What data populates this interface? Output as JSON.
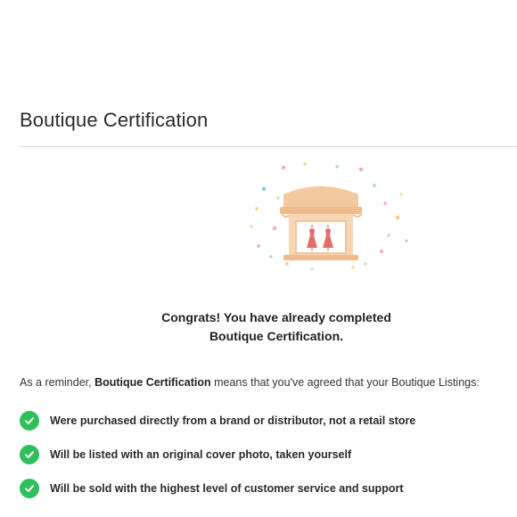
{
  "page": {
    "title": "Boutique Certification"
  },
  "congrats": {
    "line1": "Congrats! You have already completed",
    "line2": "Boutique Certification."
  },
  "reminder": {
    "prefix": "As a reminder, ",
    "emphasis": "Boutique Certification",
    "suffix": " means that you've agreed that your Boutique Listings:"
  },
  "requirements": [
    {
      "text": "Were purchased directly from a brand or distributor, not a retail store",
      "icon": "check-circle-icon"
    },
    {
      "text": "Will be listed with an original cover photo, taken yourself",
      "icon": "check-circle-icon"
    },
    {
      "text": "Will be sold with the highest level of customer service and support",
      "icon": "check-circle-icon"
    }
  ],
  "colors": {
    "check": "#2fbf5a",
    "awning": "#f4c9a0",
    "dress": "#e86a6a"
  }
}
